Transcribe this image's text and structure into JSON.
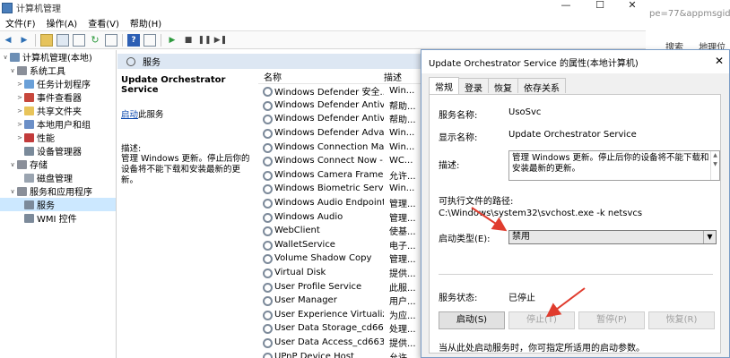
{
  "window": {
    "title": "计算机管理",
    "minimize": "—",
    "maximize": "☐",
    "close": "✕"
  },
  "menu": [
    "文件(F)",
    "操作(A)",
    "查看(V)",
    "帮助(H)"
  ],
  "tree": [
    {
      "label": "计算机管理(本地)",
      "level": 0,
      "expander": "∨",
      "icon_color": "#6d8fb5"
    },
    {
      "label": "系统工具",
      "level": 1,
      "expander": "∨",
      "icon_color": "#8a8f99"
    },
    {
      "label": "任务计划程序",
      "level": 2,
      "expander": ">",
      "icon_color": "#6aa0d8"
    },
    {
      "label": "事件查看器",
      "level": 2,
      "expander": ">",
      "icon_color": "#c7473c"
    },
    {
      "label": "共享文件夹",
      "level": 2,
      "expander": ">",
      "icon_color": "#e8c45a"
    },
    {
      "label": "本地用户和组",
      "level": 2,
      "expander": ">",
      "icon_color": "#6b8fc7"
    },
    {
      "label": "性能",
      "level": 2,
      "expander": ">",
      "icon_color": "#c23b3b"
    },
    {
      "label": "设备管理器",
      "level": 2,
      "expander": "",
      "icon_color": "#7a8a9a"
    },
    {
      "label": "存储",
      "level": 1,
      "expander": "∨",
      "icon_color": "#8a8f99"
    },
    {
      "label": "磁盘管理",
      "level": 2,
      "expander": "",
      "icon_color": "#9aa4b0"
    },
    {
      "label": "服务和应用程序",
      "level": 1,
      "expander": "∨",
      "icon_color": "#8a8f99"
    },
    {
      "label": "服务",
      "level": 2,
      "expander": "",
      "icon_color": "#7c8a9a",
      "selected": true
    },
    {
      "label": "WMI 控件",
      "level": 2,
      "expander": "",
      "icon_color": "#7c8a9a"
    }
  ],
  "services_pane": {
    "header": "服务",
    "selected_name": "Update Orchestrator Service",
    "start_link": "启动",
    "start_suffix": "此服务",
    "desc_label": "描述:",
    "desc_text": "管理 Windows 更新。停止后你的设备将不能下载和安装最新的更新。",
    "columns": {
      "name": "名称",
      "desc": "描述"
    },
    "rows": [
      {
        "name": "Windows Defender 安全...",
        "desc": "Win..."
      },
      {
        "name": "Windows Defender Antivi...",
        "desc": "帮助..."
      },
      {
        "name": "Windows Defender Antivi...",
        "desc": "帮助..."
      },
      {
        "name": "Windows Defender Adva...",
        "desc": "Win..."
      },
      {
        "name": "Windows Connection Ma...",
        "desc": "Win..."
      },
      {
        "name": "Windows Connect Now -...",
        "desc": "WC..."
      },
      {
        "name": "Windows Camera Frame ...",
        "desc": "允许..."
      },
      {
        "name": "Windows Biometric Servi...",
        "desc": "Win..."
      },
      {
        "name": "Windows Audio Endpoint...",
        "desc": "管理..."
      },
      {
        "name": "Windows Audio",
        "desc": "管理..."
      },
      {
        "name": "WebClient",
        "desc": "使基..."
      },
      {
        "name": "WalletService",
        "desc": "电子..."
      },
      {
        "name": "Volume Shadow Copy",
        "desc": "管理..."
      },
      {
        "name": "Virtual Disk",
        "desc": "提供..."
      },
      {
        "name": "User Profile Service",
        "desc": "此服..."
      },
      {
        "name": "User Manager",
        "desc": "用户..."
      },
      {
        "name": "User Experience Virtualiz...",
        "desc": "为应..."
      },
      {
        "name": "User Data Storage_cd663",
        "desc": "处理..."
      },
      {
        "name": "User Data Access_cd663",
        "desc": "提供..."
      },
      {
        "name": "UPnP Device Host",
        "desc": "允许..."
      }
    ]
  },
  "background": {
    "url_fragment": "pe=77&appmsgid=",
    "nav": [
      "搜索",
      "地理位"
    ]
  },
  "dialog": {
    "title": "Update Orchestrator Service 的属性(本地计算机)",
    "close": "✕",
    "tabs": [
      "常规",
      "登录",
      "恢复",
      "依存关系"
    ],
    "service_name_label": "服务名称:",
    "service_name": "UsoSvc",
    "display_name_label": "显示名称:",
    "display_name": "Update Orchestrator Service",
    "description_label": "描述:",
    "description": "管理 Windows 更新。停止后你的设备将不能下载和安装最新的更新。",
    "exe_path_label": "可执行文件的路径:",
    "exe_path": "C:\\Windows\\system32\\svchost.exe -k netsvcs",
    "startup_type_label": "启动类型(E):",
    "startup_type": "禁用",
    "status_label": "服务状态:",
    "status": "已停止",
    "buttons": {
      "start": "启动(S)",
      "stop": "停止(T)",
      "pause": "暂停(P)",
      "resume": "恢复(R)"
    },
    "hint": "当从此处启动服务时，你可指定所适用的启动参数。",
    "arrow_color": "#e03c2e"
  }
}
